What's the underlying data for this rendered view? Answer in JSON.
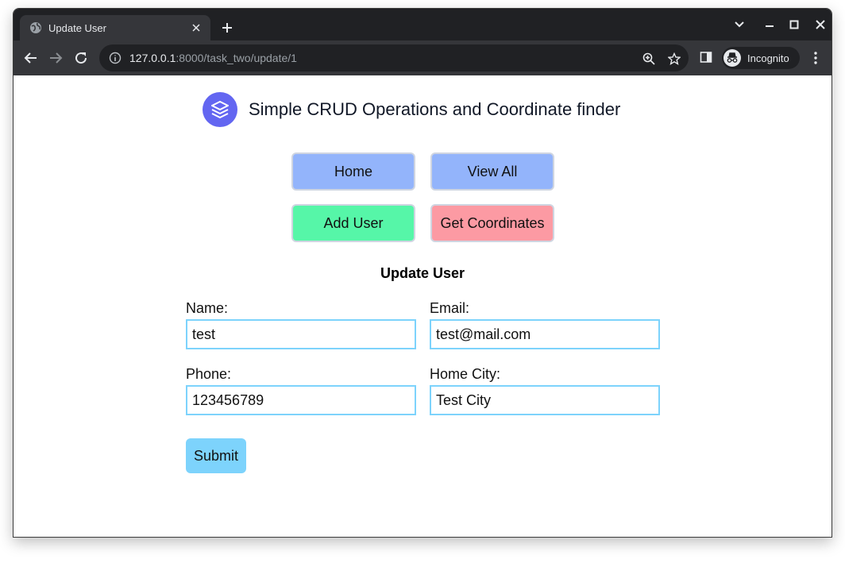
{
  "browser": {
    "tab_title": "Update User",
    "url_host": "127.0.0.1",
    "url_rest": ":8000/task_two/update/1",
    "profile_label": "Incognito"
  },
  "header": {
    "title": "Simple CRUD Operations and Coordinate finder"
  },
  "nav": {
    "home": "Home",
    "view_all": "View All",
    "add_user": "Add User",
    "get_coordinates": "Get Coordinates"
  },
  "colors": {
    "nav_blue": "#93b4fb",
    "nav_green": "#56f6a8",
    "nav_red": "#fc9aa3",
    "input_border": "#7dd3fc",
    "logo": "#6366f1"
  },
  "form": {
    "title": "Update User",
    "name_label": "Name:",
    "name_value": "test",
    "email_label": "Email:",
    "email_value": "test@mail.com",
    "phone_label": "Phone:",
    "phone_value": "123456789",
    "city_label": "Home City:",
    "city_value": "Test City",
    "submit_label": "Submit"
  }
}
